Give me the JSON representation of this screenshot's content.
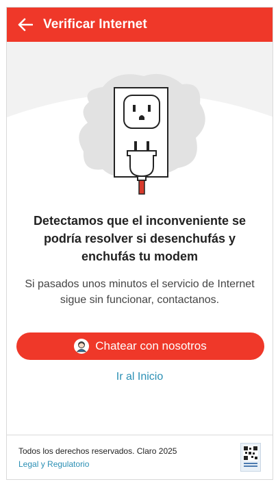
{
  "header": {
    "title": "Verificar Internet",
    "back_icon": "arrow-left-icon",
    "color": "#ef3829"
  },
  "hero": {
    "illustration": "plug-and-outlet-icon"
  },
  "message": {
    "headline": "Detectamos que el inconveniente se podría resolver si desenchufás y enchufás tu modem",
    "body": "Si pasados unos minutos el servicio de Internet sigue sin funcionar, contactanos."
  },
  "actions": {
    "chat_label": "Chatear con nosotros",
    "chat_icon": "agent-avatar-icon",
    "home_label": "Ir al Inicio"
  },
  "footer": {
    "rights": "Todos los derechos reservados. Claro 2025",
    "legal_label": "Legal y Regulatorio",
    "badge": "data-fiscal-qr-icon"
  },
  "colors": {
    "accent": "#ef3829",
    "link": "#2a8fb4"
  }
}
